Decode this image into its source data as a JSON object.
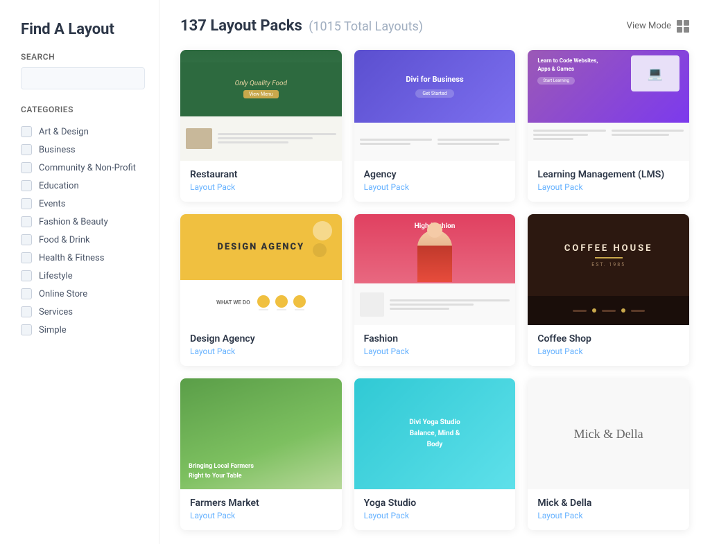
{
  "sidebar": {
    "title": "Find A Layout",
    "search_label": "Search",
    "search_placeholder": "",
    "categories_label": "Categories",
    "categories": [
      {
        "id": "art-design",
        "name": "Art & Design"
      },
      {
        "id": "business",
        "name": "Business"
      },
      {
        "id": "community-non-profit",
        "name": "Community & Non-Profit"
      },
      {
        "id": "education",
        "name": "Education"
      },
      {
        "id": "events",
        "name": "Events"
      },
      {
        "id": "fashion-beauty",
        "name": "Fashion & Beauty"
      },
      {
        "id": "food-drink",
        "name": "Food & Drink"
      },
      {
        "id": "health-fitness",
        "name": "Health & Fitness"
      },
      {
        "id": "lifestyle",
        "name": "Lifestyle"
      },
      {
        "id": "online-store",
        "name": "Online Store"
      },
      {
        "id": "services",
        "name": "Services"
      },
      {
        "id": "simple",
        "name": "Simple"
      }
    ]
  },
  "main": {
    "title": "137 Layout Packs",
    "count_label": "(1015 Total Layouts)",
    "view_mode_label": "View Mode",
    "cards": [
      {
        "id": "restaurant",
        "name": "Restaurant",
        "type": "Layout Pack",
        "row": 1
      },
      {
        "id": "agency",
        "name": "Agency",
        "type": "Layout Pack",
        "row": 1
      },
      {
        "id": "lms",
        "name": "Learning Management (LMS)",
        "type": "Layout Pack",
        "row": 1
      },
      {
        "id": "design-agency",
        "name": "Design Agency",
        "type": "Layout Pack",
        "row": 2
      },
      {
        "id": "fashion",
        "name": "Fashion",
        "type": "Layout Pack",
        "row": 2
      },
      {
        "id": "coffee-shop",
        "name": "Coffee Shop",
        "type": "Layout Pack",
        "row": 2
      },
      {
        "id": "farmers",
        "name": "Farmers Market",
        "type": "Layout Pack",
        "row": 3
      },
      {
        "id": "yoga",
        "name": "Yoga Studio",
        "type": "Layout Pack",
        "row": 3
      },
      {
        "id": "mick",
        "name": "Mick & Della",
        "type": "Layout Pack",
        "row": 3
      }
    ]
  }
}
